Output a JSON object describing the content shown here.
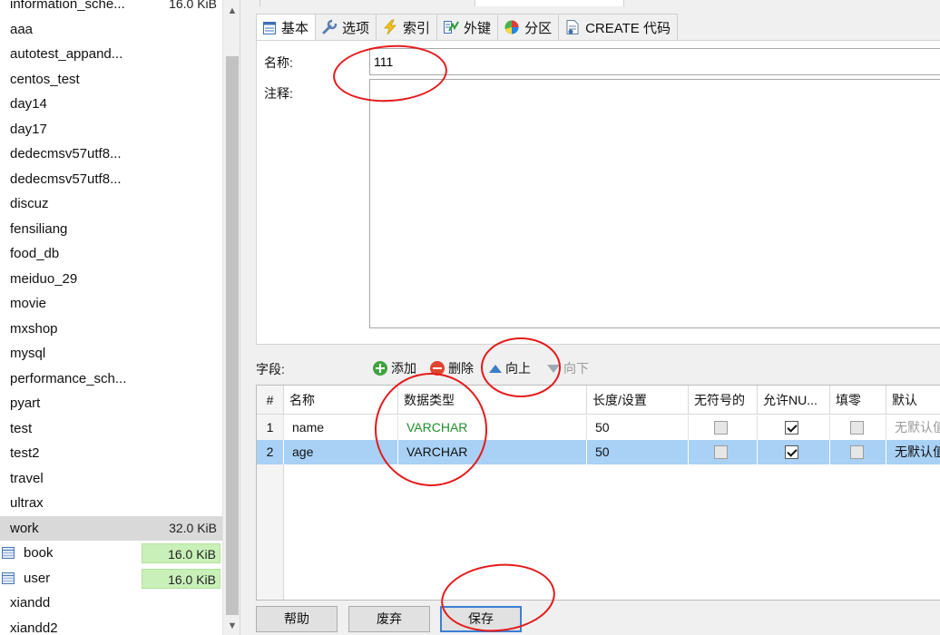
{
  "tree": {
    "items": [
      {
        "label": "information_sche...",
        "size": "16.0 KiB"
      },
      {
        "label": "aaa"
      },
      {
        "label": "autotest_appand..."
      },
      {
        "label": "centos_test"
      },
      {
        "label": "day14"
      },
      {
        "label": "day17"
      },
      {
        "label": "dedecmsv57utf8..."
      },
      {
        "label": "dedecmsv57utf8..."
      },
      {
        "label": "discuz"
      },
      {
        "label": "fensiliang"
      },
      {
        "label": "food_db"
      },
      {
        "label": "meiduo_29"
      },
      {
        "label": "movie"
      },
      {
        "label": "mxshop"
      },
      {
        "label": "mysql"
      },
      {
        "label": "performance_sch..."
      },
      {
        "label": "pyart"
      },
      {
        "label": "test"
      },
      {
        "label": "test2"
      },
      {
        "label": "travel"
      },
      {
        "label": "ultrax"
      },
      {
        "label": "work",
        "size": "32.0 KiB",
        "selected": true
      },
      {
        "label": "book",
        "size": "16.0 KiB",
        "child": true
      },
      {
        "label": "user",
        "size": "16.0 KiB",
        "child": true
      },
      {
        "label": "xiandd"
      },
      {
        "label": "xiandd2"
      }
    ]
  },
  "tabs": [
    {
      "label": "基本",
      "icon": "grid-icon"
    },
    {
      "label": "选项",
      "icon": "wrench-icon"
    },
    {
      "label": "索引",
      "icon": "lightning-icon"
    },
    {
      "label": "外键",
      "icon": "foreign-key-icon"
    },
    {
      "label": "分区",
      "icon": "pie-chart-icon"
    },
    {
      "label": "CREATE 代码",
      "icon": "code-page-icon"
    }
  ],
  "form": {
    "name_label": "名称:",
    "name_value": "111",
    "comment_label": "注释:"
  },
  "fields": {
    "label": "字段:",
    "toolbar": {
      "add": "添加",
      "delete": "删除",
      "move_up": "向上",
      "move_down": "向下"
    },
    "columns": [
      "#",
      "名称",
      "数据类型",
      "长度/设置",
      "无符号的",
      "允许NU...",
      "填零",
      "默认"
    ],
    "rows": [
      {
        "num": "1",
        "name": "name",
        "type": "VARCHAR",
        "length": "50",
        "unsigned": false,
        "allow_null": true,
        "zerofill": false,
        "default": "无默认值"
      },
      {
        "num": "2",
        "name": "age",
        "type": "VARCHAR",
        "length": "50",
        "unsigned": false,
        "allow_null": true,
        "zerofill": false,
        "default": "无默认值",
        "selected": true
      }
    ]
  },
  "buttons": {
    "help": "帮助",
    "discard": "废弃",
    "save": "保存"
  },
  "colors": {
    "annotation": "#e51a1a",
    "selected_row": "#a8d1f5",
    "type_green": "#1f8f2a",
    "size_highlight": "#c8f0b8"
  }
}
